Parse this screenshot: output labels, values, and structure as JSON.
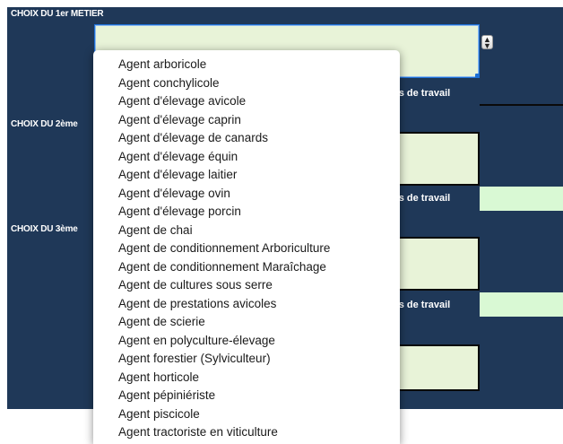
{
  "sections": {
    "first": {
      "title": "CHOIX DU 1er METIER",
      "time_label": "ps de travail"
    },
    "second": {
      "title": "CHOIX DU 2ème",
      "time_label": "ps de travail"
    },
    "third": {
      "title": "CHOIX DU 3ème",
      "time_label": "ps de travail"
    }
  },
  "stepper_icon": "up-down-arrows-icon",
  "colors": {
    "panel": "#1f3858",
    "field": "#e8f3d8",
    "time_field": "#d9f9d4",
    "focus": "#1d6fd6"
  },
  "dropdown": {
    "options": [
      "Agent arboricole",
      "Agent conchylicole",
      "Agent d'élevage avicole",
      "Agent d'élevage caprin",
      "Agent d'élevage de canards",
      "Agent d'élevage équin",
      "Agent d'élevage laitier",
      "Agent d'élevage ovin",
      "Agent d'élevage porcin",
      "Agent de chai",
      "Agent de conditionnement Arboriculture",
      "Agent de conditionnement Maraîchage",
      "Agent de cultures sous serre",
      "Agent de prestations avicoles",
      "Agent de scierie",
      "Agent en polyculture-élevage",
      "Agent forestier (Sylviculteur)",
      "Agent horticole",
      "Agent pépiniériste",
      "Agent piscicole",
      "Agent tractoriste en viticulture"
    ]
  }
}
